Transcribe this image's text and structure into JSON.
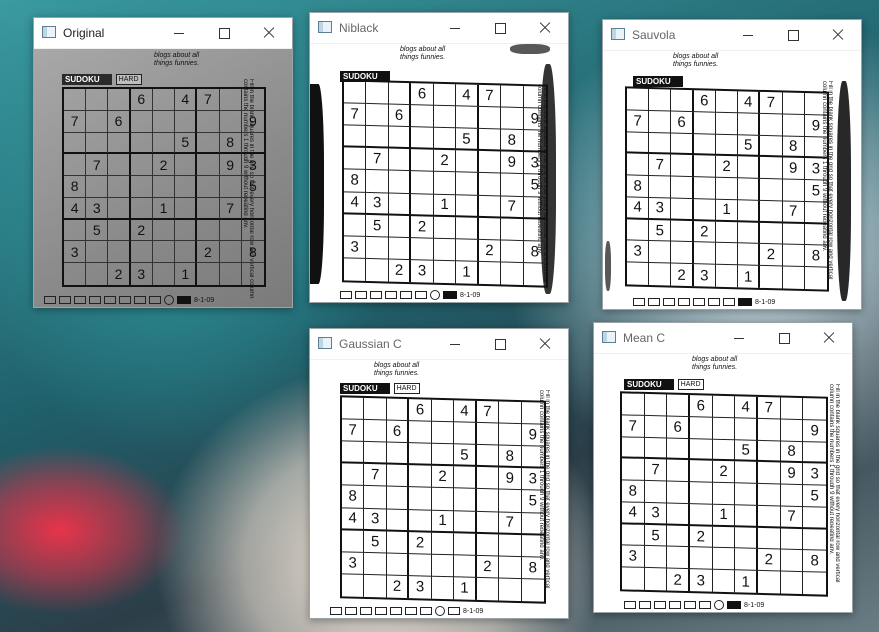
{
  "windows": {
    "original": {
      "title": "Original"
    },
    "niblack": {
      "title": "Niblack"
    },
    "sauvola": {
      "title": "Sauvola"
    },
    "gaussian": {
      "title": "Gaussian C"
    },
    "mean": {
      "title": "Mean C"
    }
  },
  "icons": {
    "app": "window-app-icon",
    "minimize": "minimize-icon",
    "maximize": "maximize-icon",
    "close": "close-icon"
  },
  "paper": {
    "tag": "SUDOKU",
    "level": "HARD",
    "blog_line1": "blogs about all",
    "blog_line2": "things funnies.",
    "side_text": "Fill in the blank squares in the grid so that every horizontal row and vertical column contains the numbers 1 through 9 without repeating any.",
    "footer_code": "8-1-09"
  },
  "puzzle": [
    [
      "",
      "",
      "",
      "6",
      "",
      "4",
      "7",
      "",
      ""
    ],
    [
      "7",
      "",
      "6",
      "",
      "",
      "",
      "",
      "",
      "9"
    ],
    [
      "",
      "",
      "",
      "",
      "",
      "5",
      "",
      "8",
      ""
    ],
    [
      "",
      "7",
      "",
      "",
      "2",
      "",
      "",
      "9",
      "3"
    ],
    [
      "8",
      "",
      "",
      "",
      "",
      "",
      "",
      "",
      "5"
    ],
    [
      "4",
      "3",
      "",
      "",
      "1",
      "",
      "",
      "7",
      ""
    ],
    [
      "",
      "5",
      "",
      "2",
      "",
      "",
      "",
      "",
      ""
    ],
    [
      "3",
      "",
      "",
      "",
      "",
      "",
      "2",
      "",
      "8"
    ],
    [
      "",
      "",
      "2",
      "3",
      "",
      "1",
      "",
      "",
      ""
    ]
  ]
}
